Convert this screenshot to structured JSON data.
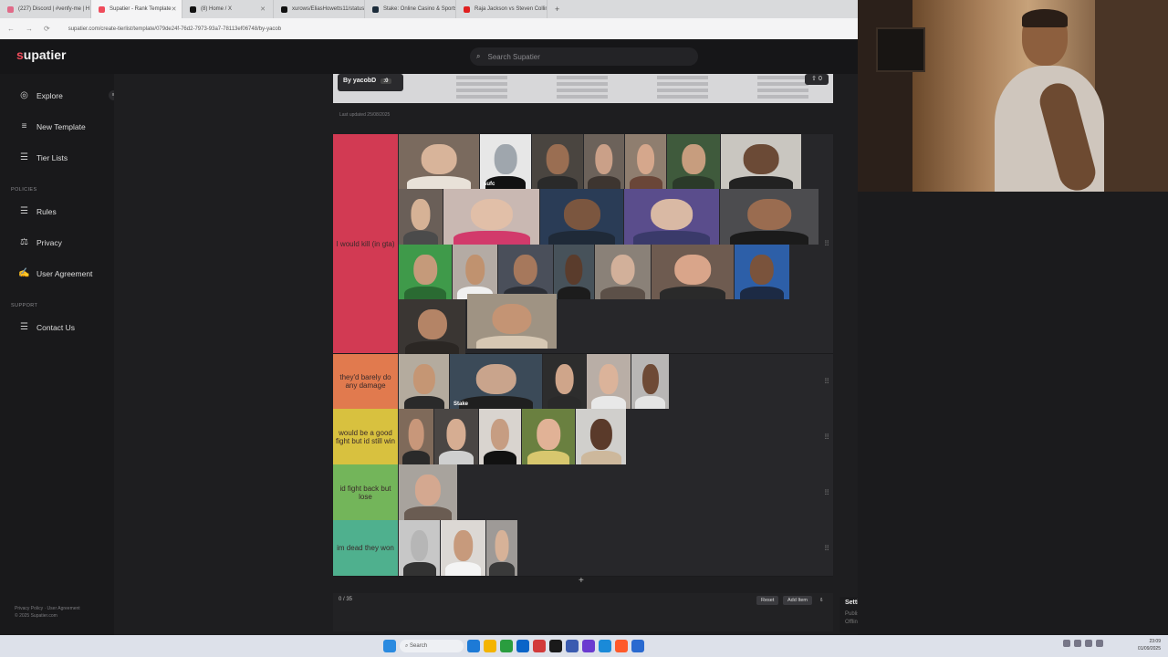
{
  "browser": {
    "tabs": [
      {
        "title": "(227) Discord | #venfy-me | H",
        "color": "#e16a88",
        "active": false
      },
      {
        "title": "Supatier - Rank Template",
        "color": "#ef4c5b",
        "active": true
      },
      {
        "title": "(8) Home / X",
        "color": "#111111",
        "active": false
      },
      {
        "title": "xurows/EliasHowetts11/status",
        "color": "#111111",
        "active": false
      },
      {
        "title": "Stake: Online Casino & Sports",
        "color": "#1b2b3a",
        "active": false
      },
      {
        "title": "Raja Jackson vs Steven Collins",
        "color": "#e02020",
        "active": false
      }
    ],
    "new_tab": "+",
    "url": "supatier.com/create-tierlist/template/079de24f-76d2-7973-93a7-78113ef06748/by-yacob"
  },
  "site": {
    "logo_first": "s",
    "logo_rest": "upatier",
    "search_placeholder": "Search Supatier"
  },
  "sidebar": {
    "items": [
      {
        "label": "Explore",
        "icon": "compass-icon",
        "glyph": "◎"
      },
      {
        "label": "New Template",
        "icon": "list-add-icon",
        "glyph": "≡"
      },
      {
        "label": "Tier Lists",
        "icon": "list-icon",
        "glyph": "☰"
      }
    ],
    "policies_heading": "POLICIES",
    "policy_items": [
      {
        "label": "Rules",
        "icon": "document-icon",
        "glyph": "☰"
      },
      {
        "label": "Privacy",
        "icon": "scales-icon",
        "glyph": "⚖"
      },
      {
        "label": "User Agreement",
        "icon": "handshake-icon",
        "glyph": "✍"
      }
    ],
    "support_heading": "SUPPORT",
    "support_items": [
      {
        "label": "Contact Us",
        "icon": "chat-icon",
        "glyph": "☰"
      }
    ],
    "footer_links": "Privacy Policy · User Agreement",
    "footer_copy": "© 2025 Supatier.com"
  },
  "template": {
    "author": "By yacobD",
    "author_count": ":0",
    "upvotes": "⇧ 0",
    "last_updated": "Last updated 25/08/2025"
  },
  "tiers": [
    {
      "label": "I would kill (in gta)",
      "color": "#d23a53"
    },
    {
      "label": "they'd barely do any damage",
      "color": "#e17a4e"
    },
    {
      "label": "would be a good fight but id still win",
      "color": "#d8c13f"
    },
    {
      "label": "id fight back but lose",
      "color": "#73b55a"
    },
    {
      "label": "im dead they won",
      "color": "#4fb08e"
    }
  ],
  "tier_items": [
    [
      {
        "bg": "#7a6a5e",
        "skin": "#d8b49a",
        "shirt": "#e8e1d8"
      },
      {
        "bg": "#e7e7e7",
        "skin": "#9fa6ad",
        "shirt": "#111111",
        "caption": "sufc"
      },
      {
        "bg": "#4a4540",
        "skin": "#9a6e52",
        "shirt": "#2a2a2a"
      },
      {
        "bg": "#6c625a",
        "skin": "#caa088",
        "shirt": "#3d3530"
      },
      {
        "bg": "#8f7e6f",
        "skin": "#d5a78c",
        "shirt": "#6a4638"
      },
      {
        "bg": "#3f5a3c",
        "skin": "#c79d7e",
        "shirt": "#2b3a2a"
      },
      {
        "bg": "#c9c6c0",
        "skin": "#6b4a36",
        "shirt": "#222222"
      },
      {
        "bg": "#6a5f58",
        "skin": "#d6b296",
        "shirt": "#4b4b4b"
      },
      {
        "bg": "#c9b8b2",
        "skin": "#e1bfa8",
        "shirt": "#d23a6b"
      },
      {
        "bg": "#2a3c56",
        "skin": "#7b563f",
        "shirt": "#1f2a38"
      },
      {
        "bg": "#5a4d8c",
        "skin": "#d9b9a4",
        "shirt": "#3a3a6a"
      },
      {
        "bg": "#4c4c4f",
        "skin": "#9a6c50",
        "shirt": "#1b1b1b"
      },
      {
        "bg": "#3f9a4a",
        "skin": "#c59a7a",
        "shirt": "#2a6a32"
      },
      {
        "bg": "#b4aba4",
        "skin": "#c0926f",
        "shirt": "#f0f0f0"
      },
      {
        "bg": "#4a4f5a",
        "skin": "#a6785c",
        "shirt": "#2c2f36"
      },
      {
        "bg": "#47525a",
        "skin": "#5a3c2c",
        "shirt": "#1c1c1c"
      },
      {
        "bg": "#8a8178",
        "skin": "#d2b09a",
        "shirt": "#5c5048"
      },
      {
        "bg": "#6e5b50",
        "skin": "#d9a58a",
        "shirt": "#2a2a2a"
      },
      {
        "bg": "#2d5fa8",
        "skin": "#7a533c",
        "shirt": "#1c2a44"
      },
      {
        "bg": "#3a3633",
        "skin": "#b48466",
        "shirt": "#2b2724"
      },
      {
        "bg": "#9f9383",
        "skin": "#c49474",
        "shirt": "#d6c7b3"
      }
    ],
    [
      {
        "bg": "#b4ab9e",
        "skin": "#c59674",
        "shirt": "#2a2a2a"
      },
      {
        "bg": "#3b4a58",
        "skin": "#c9a48c",
        "shirt": "#1f1f1f",
        "caption": "Stake"
      },
      {
        "bg": "#2d2d2d",
        "skin": "#cfa58a",
        "shirt": "#2a2a2a"
      },
      {
        "bg": "#b9aea6",
        "skin": "#dbb39a",
        "shirt": "#e8e8e8"
      },
      {
        "bg": "#b8b6b5",
        "skin": "#6e4a36",
        "shirt": "#e4e4e4"
      }
    ],
    [
      {
        "bg": "#7f6a5a",
        "skin": "#c8977a",
        "shirt": "#2a2a2a"
      },
      {
        "bg": "#4a4644",
        "skin": "#d6ad92",
        "shirt": "#cfcfcf"
      },
      {
        "bg": "#d9d4cf",
        "skin": "#c69d82",
        "shirt": "#111111"
      },
      {
        "bg": "#6a8040",
        "skin": "#e1b296",
        "shirt": "#d8c76e"
      },
      {
        "bg": "#d0cfcc",
        "skin": "#5a3a2a",
        "shirt": "#cdb89c"
      }
    ],
    [
      {
        "bg": "#a8a39d",
        "skin": "#d4a890",
        "shirt": "#6a5c52"
      }
    ],
    [
      {
        "bg": "#c7c7c7",
        "skin": "#b6b6b6",
        "shirt": "#333333"
      },
      {
        "bg": "#dcd8d4",
        "skin": "#c79a7c",
        "shirt": "#f4f4f4"
      },
      {
        "bg": "#9e9a97",
        "skin": "#d7b298",
        "shirt": "#3a3a3a"
      }
    ]
  ],
  "add_row": "+",
  "bottom": {
    "count": "0 / 35",
    "reset": "Reset",
    "add_item": "Add Item",
    "download": "⇩"
  },
  "settings": {
    "title": "Settings",
    "option1": "Publish Changes",
    "option2": "Offline Mode"
  },
  "taskbar": {
    "search": "Search",
    "time": "23:09",
    "date": "01/09/2025",
    "app_colors": [
      "#1d7ad6",
      "#f4b400",
      "#2a9d3f",
      "#0a64c8",
      "#d23a3a",
      "#1a1a1a",
      "#3a5bb0",
      "#6a3ad0",
      "#1a8ad8",
      "#ff5a2a",
      "#2a6ad0"
    ]
  }
}
